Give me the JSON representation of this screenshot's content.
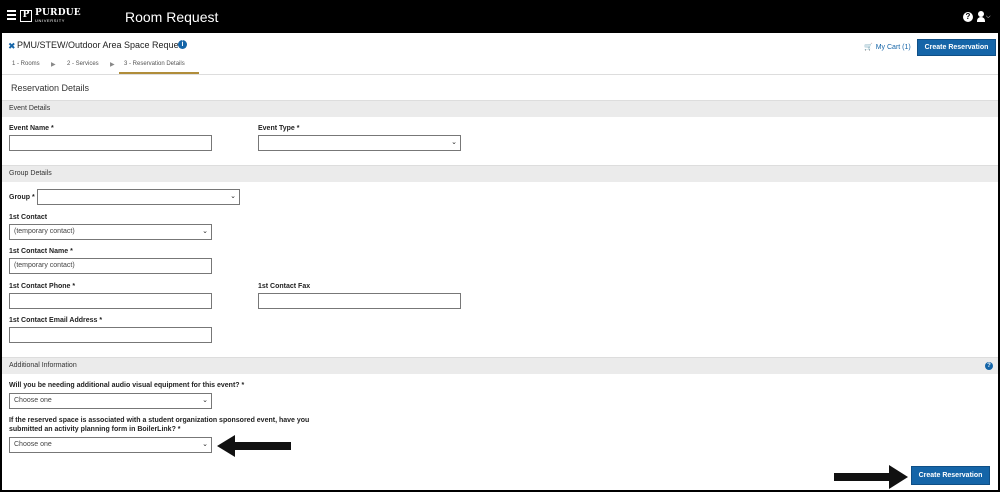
{
  "app": {
    "title": "Room Request",
    "logo_word": "PURDUE",
    "logo_sub": "UNIVERSITY",
    "logo_mark": "P"
  },
  "header": {
    "request_title": "PMU/STEW/Outdoor Area Space Request",
    "cart_label": "My Cart (1)",
    "create_label": "Create Reservation"
  },
  "steps": [
    {
      "label": "1 - Rooms"
    },
    {
      "label": "2 - Services"
    },
    {
      "label": "3 - Reservation Details"
    }
  ],
  "page_title": "Reservation Details",
  "event_details": {
    "section_label": "Event Details",
    "event_name_label": "Event Name *",
    "event_name_value": "",
    "event_type_label": "Event Type *",
    "event_type_value": ""
  },
  "group_details": {
    "section_label": "Group Details",
    "group_label": "Group *",
    "group_value": "",
    "contact_label": "1st Contact",
    "contact_value": "(temporary contact)",
    "contact_name_label": "1st Contact Name *",
    "contact_name_value": "(temporary contact)",
    "contact_phone_label": "1st Contact Phone *",
    "contact_phone_value": "",
    "contact_fax_label": "1st Contact Fax",
    "contact_fax_value": "",
    "contact_email_label": "1st Contact Email Address *",
    "contact_email_value": ""
  },
  "additional_info": {
    "section_label": "Additional Information",
    "av_question": "Will you be needing additional audio visual equipment for this event? *",
    "av_value": "Choose one",
    "planning_question_line1": "If the reserved space is associated with a student organization sponsored event, have you",
    "planning_question_line2": "submitted an activity planning form in BoilerLink? *",
    "planning_value": "Choose one"
  },
  "footer": {
    "create_label": "Create Reservation"
  },
  "colors": {
    "accent": "#1565a8",
    "topbar": "#000000",
    "step_underline": "#b08d3a"
  },
  "icons": {
    "menu": "hamburger-icon",
    "user": "user-icon",
    "help": "question-circle-icon",
    "info": "info-circle-icon",
    "cart": "cart-icon",
    "close": "close-icon"
  }
}
